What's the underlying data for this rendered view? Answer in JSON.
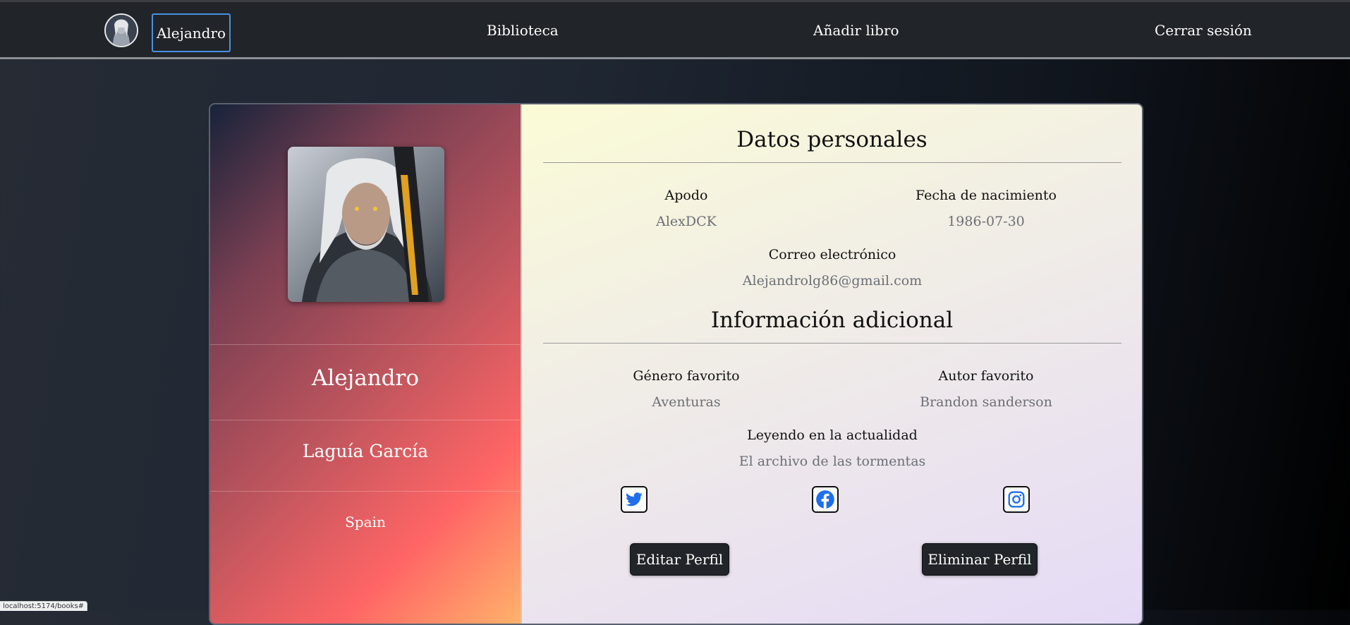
{
  "nav": {
    "user_label": "Alejandro",
    "library_label": "Biblioteca",
    "add_book_label": "Añadir libro",
    "logout_label": "Cerrar sesión"
  },
  "profile": {
    "first_name": "Alejandro",
    "last_name": "Laguía García",
    "country": "Spain"
  },
  "personal": {
    "title": "Datos personales",
    "nickname_label": "Apodo",
    "nickname": "AlexDCK",
    "birth_label": "Fecha de nacimiento",
    "birth_date": "1986-07-30",
    "email_label": "Correo electrónico",
    "email": "Alejandrolg86@gmail.com"
  },
  "extra": {
    "title": "Información adicional",
    "genre_label": "Género favorito",
    "genre": "Aventuras",
    "author_label": "Autor favorito",
    "author": "Brandon sanderson",
    "reading_label": "Leyendo en la actualidad",
    "reading": "El archivo de las tormentas"
  },
  "social": [
    "twitter-icon",
    "facebook-icon",
    "instagram-icon"
  ],
  "actions": {
    "edit_label": "Editar Perfil",
    "delete_label": "Eliminar Perfil"
  },
  "status_bar": "localhost:5174/books#",
  "colors": {
    "nav_bg": "#212429",
    "active_border": "#4a90e2",
    "button_bg": "#212529",
    "social_icon": "#1f6feb"
  }
}
